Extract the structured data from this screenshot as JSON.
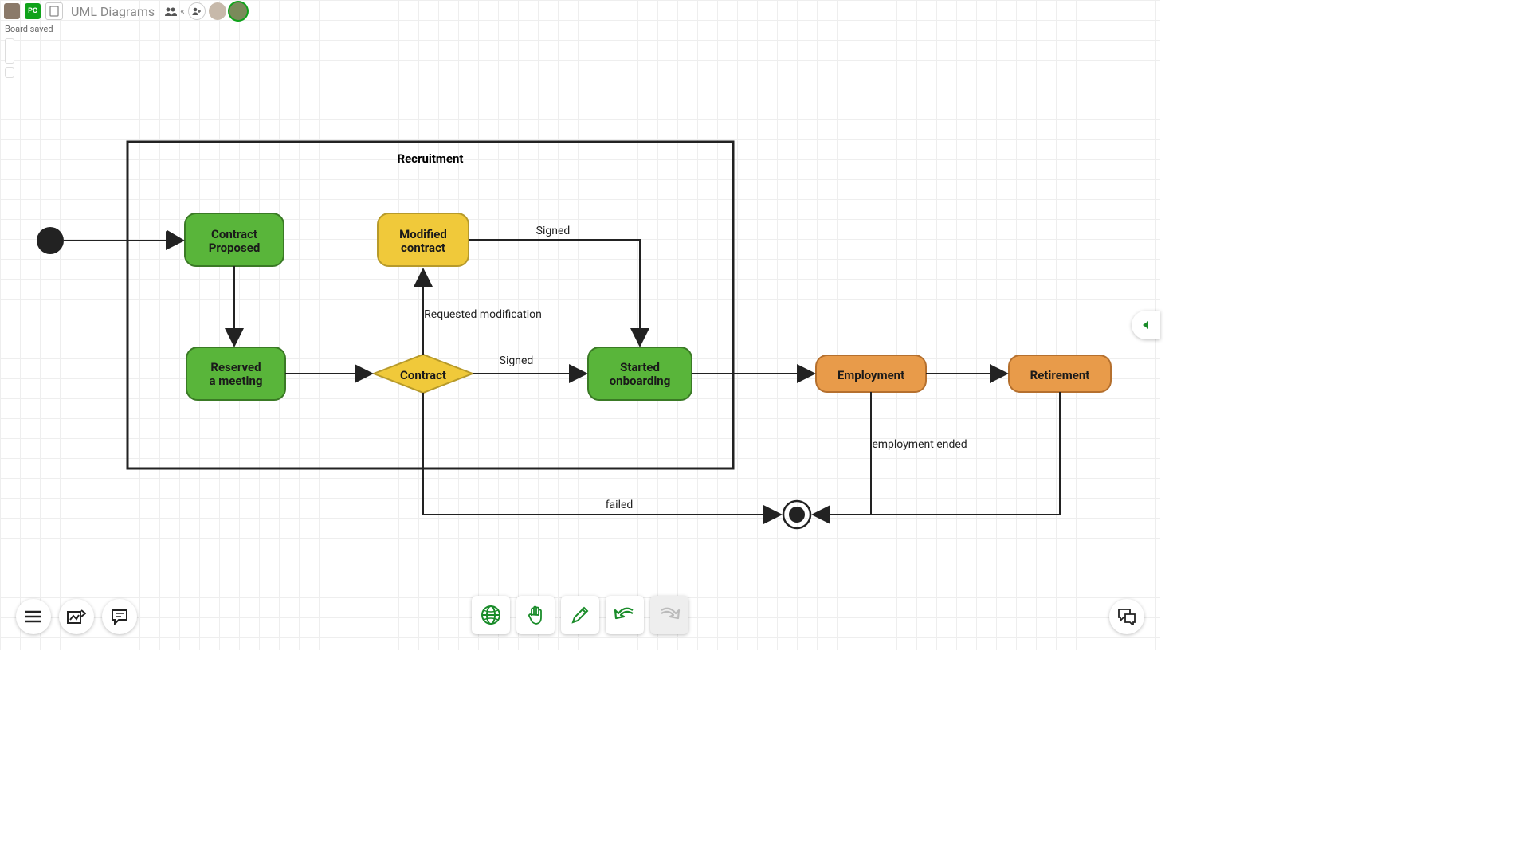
{
  "header": {
    "title": "UML Diagrams",
    "status": "Board saved",
    "avatars": [
      {
        "label": "",
        "color": "#8b7a6a"
      },
      {
        "label": "PC",
        "color": "#0fa21a"
      }
    ]
  },
  "frame": {
    "title": "Recruitment"
  },
  "nodes": {
    "contract_proposed": "Contract\nProposed",
    "reserved_meeting": "Reserved\na meeting",
    "modified_contract": "Modified\ncontract",
    "contract": "Contract",
    "started_onboarding": "Started\nonboarding",
    "employment": "Employment",
    "retirement": "Retirement"
  },
  "edges": {
    "signed1": "Signed",
    "signed2": "Signed",
    "requested_mod": "Requested modification",
    "employment_ended": "employment ended",
    "failed": "failed"
  },
  "toolbar": {
    "menu": "menu",
    "export": "export",
    "comments": "comments",
    "globe": "globe",
    "hand": "hand",
    "pencil": "pencil",
    "undo": "undo",
    "redo": "redo",
    "chat": "chat"
  },
  "chart_data": {
    "type": "uml-state-diagram",
    "title": "Recruitment",
    "nodes": [
      {
        "id": "start",
        "type": "initial"
      },
      {
        "id": "contract_proposed",
        "type": "state",
        "label": "Contract Proposed",
        "color": "green"
      },
      {
        "id": "reserved_meeting",
        "type": "state",
        "label": "Reserved a meeting",
        "color": "green"
      },
      {
        "id": "modified_contract",
        "type": "state",
        "label": "Modified contract",
        "color": "yellow"
      },
      {
        "id": "contract",
        "type": "decision",
        "label": "Contract",
        "color": "yellow"
      },
      {
        "id": "started_onboarding",
        "type": "state",
        "label": "Started onboarding",
        "color": "green"
      },
      {
        "id": "employment",
        "type": "state",
        "label": "Employment",
        "color": "orange"
      },
      {
        "id": "retirement",
        "type": "state",
        "label": "Retirement",
        "color": "orange"
      },
      {
        "id": "end",
        "type": "final"
      }
    ],
    "edges": [
      {
        "from": "start",
        "to": "contract_proposed",
        "label": ""
      },
      {
        "from": "contract_proposed",
        "to": "reserved_meeting",
        "label": ""
      },
      {
        "from": "reserved_meeting",
        "to": "contract",
        "label": ""
      },
      {
        "from": "contract",
        "to": "modified_contract",
        "label": "Requested modification"
      },
      {
        "from": "modified_contract",
        "to": "started_onboarding",
        "label": "Signed"
      },
      {
        "from": "contract",
        "to": "started_onboarding",
        "label": "Signed"
      },
      {
        "from": "started_onboarding",
        "to": "employment",
        "label": ""
      },
      {
        "from": "employment",
        "to": "retirement",
        "label": ""
      },
      {
        "from": "employment",
        "to": "end",
        "label": "employment ended"
      },
      {
        "from": "retirement",
        "to": "end",
        "label": ""
      },
      {
        "from": "contract",
        "to": "end",
        "label": "failed"
      }
    ],
    "frame_contains": [
      "start",
      "contract_proposed",
      "reserved_meeting",
      "modified_contract",
      "contract",
      "started_onboarding"
    ]
  }
}
